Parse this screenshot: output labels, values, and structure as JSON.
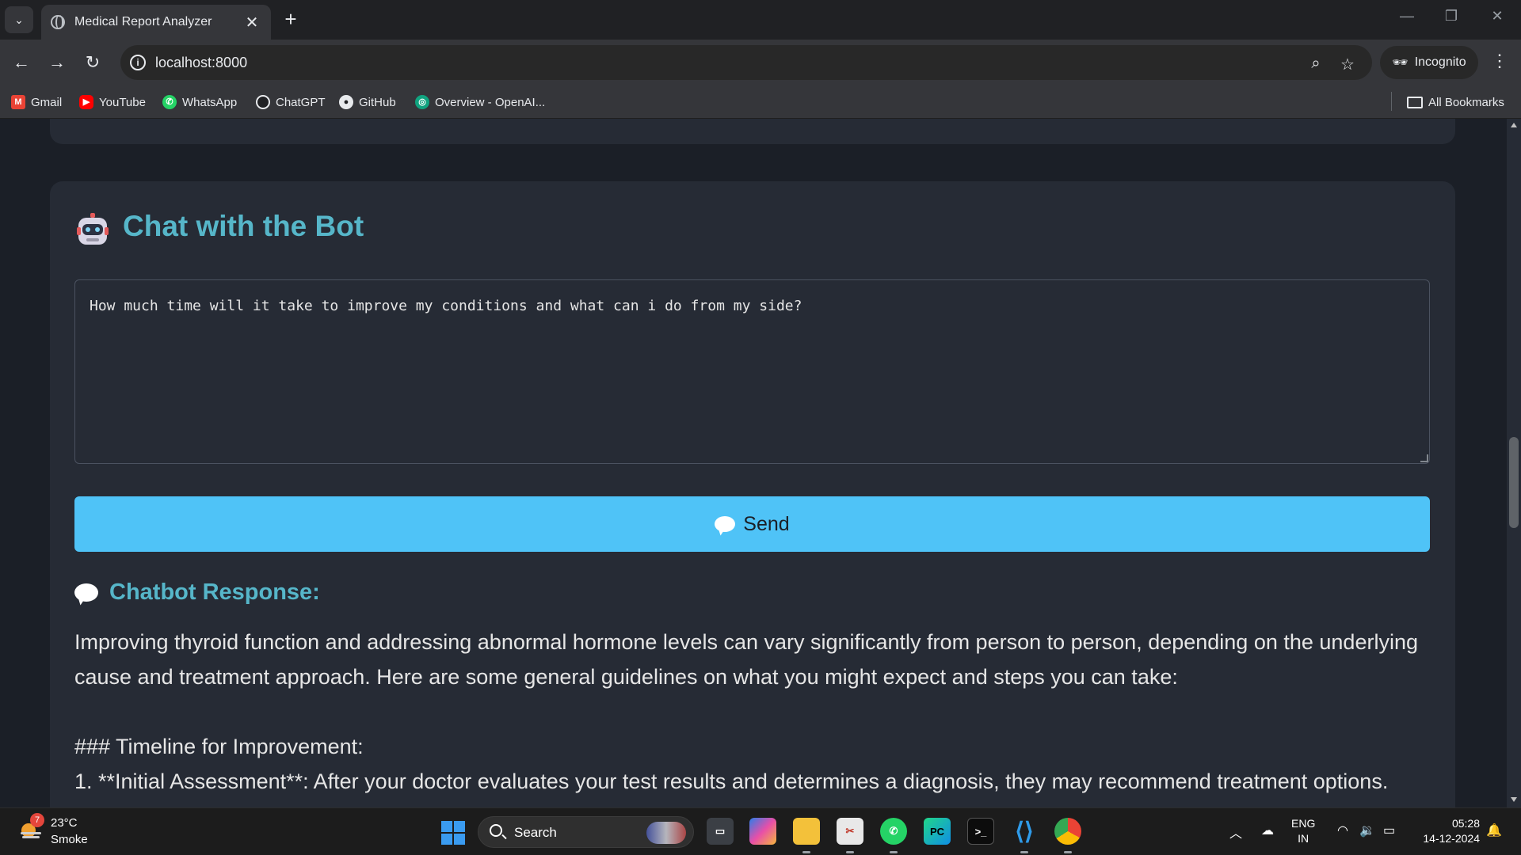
{
  "browser": {
    "tab_title": "Medical Report Analyzer",
    "tab_close": "✕",
    "new_tab": "+",
    "url": "localhost:8000",
    "profile_label": "Incognito",
    "bookmarks": [
      "Gmail",
      "YouTube",
      "WhatsApp",
      "ChatGPT",
      "GitHub",
      "Overview - OpenAI..."
    ],
    "all_bookmarks": "All Bookmarks"
  },
  "chat": {
    "title": "Chat with the Bot",
    "input_value": "How much time will it take to improve my conditions and what can i do from my side?",
    "send_label": "Send",
    "response_title": "Chatbot Response:",
    "response_paragraph": "Improving thyroid function and addressing abnormal hormone levels can vary significantly from person to person, depending on the underlying cause and treatment approach. Here are some general guidelines on what you might expect and steps you can take:",
    "response_heading": "### Timeline for Improvement:",
    "response_item_1": "1. **Initial Assessment**: After your doctor evaluates your test results and determines a diagnosis, they may recommend treatment options."
  },
  "taskbar": {
    "weather_temp": "23°C",
    "weather_desc": "Smoke",
    "weather_badge": "7",
    "search_label": "Search",
    "lang_line1": "ENG",
    "lang_line2": "IN",
    "time": "05:28",
    "date": "14-12-2024"
  },
  "colors": {
    "accent": "#56b6c9",
    "send_button": "#4fc3f7",
    "card_bg": "#262b35",
    "page_bg": "#1b1f27"
  },
  "icons": {
    "title_icon": "robot-icon",
    "send_icon": "speech-bubble-icon",
    "response_icon": "speech-bubble-icon"
  }
}
